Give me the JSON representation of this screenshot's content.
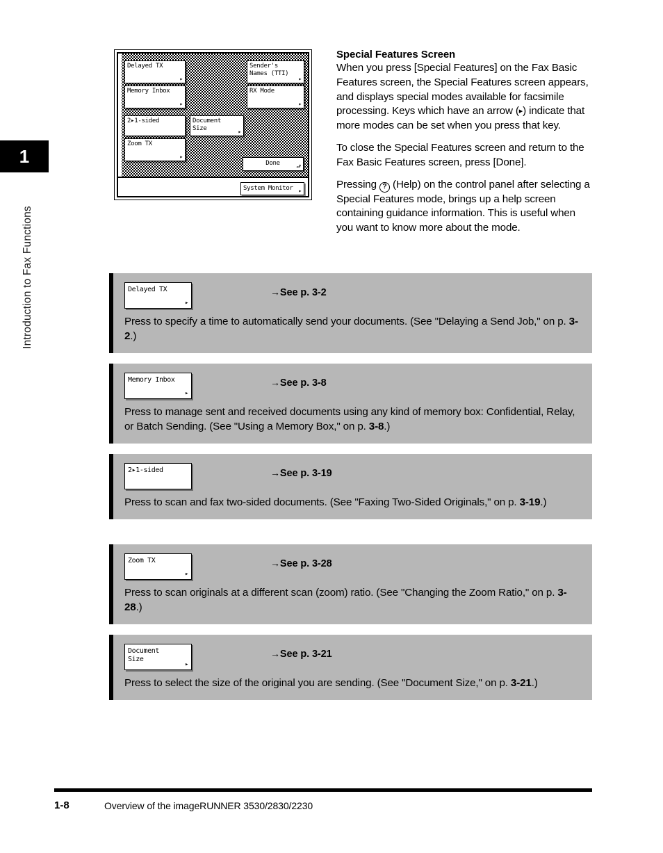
{
  "chapter": {
    "number": "1",
    "title": "Introduction to Fax Functions"
  },
  "figure": {
    "name": "special-features-lcd-screen",
    "keys": [
      {
        "id": "delayed-tx",
        "label": "Delayed TX",
        "arrow": "▸"
      },
      {
        "id": "memory-inbox",
        "label": "Memory Inbox",
        "arrow": "▸"
      },
      {
        "id": "senders-names",
        "label": "Sender's\nNames (TTI)",
        "arrow": "▸"
      },
      {
        "id": "rx-mode",
        "label": "RX Mode",
        "arrow": "▸"
      },
      {
        "id": "2-1-sided",
        "label": "2▸1-sided",
        "arrow": ""
      },
      {
        "id": "document-size",
        "label": "Document\nSize",
        "arrow": "▸"
      },
      {
        "id": "zoom-tx",
        "label": "Zoom TX",
        "arrow": "▸"
      },
      {
        "id": "done",
        "label": "Done",
        "arrow": "⮐"
      },
      {
        "id": "system-monitor",
        "label": "System Monitor",
        "arrow": "▸"
      }
    ],
    "key_labels": {
      "delayed_tx": "Delayed TX",
      "memory_inbox": "Memory Inbox",
      "senders_names_line1": "Sender's",
      "senders_names_line2": "Names (TTI)",
      "rx_mode": "RX Mode",
      "two_to_one_sided": "2▸1-sided",
      "document_size_line1": "Document",
      "document_size_line2": "Size",
      "zoom_tx": "Zoom TX",
      "done": "Done",
      "system_monitor": "System Monitor"
    }
  },
  "section": {
    "heading": "Special Features Screen",
    "paragraph_1_part_a": "When you press [Special Features] on the Fax Basic Features screen, the Special Features screen appears, and displays special modes available for facsimile processing. Keys which have an arrow (",
    "paragraph_1_arrow": "▸",
    "paragraph_1_part_b": ") indicate that more modes can be set when you press that key.",
    "paragraph_2": "To close the Special Features screen and return to the Fax Basic Features screen, press [Done].",
    "paragraph_3_part_a": "Pressing ",
    "paragraph_3_help_icon": "?",
    "paragraph_3_part_b": " (Help) on the control panel after selecting a Special Features mode, brings up a help screen containing guidance information. This is useful when you want to know more about the mode."
  },
  "callouts": [
    {
      "key_line1": "Delayed TX",
      "key_line2": "",
      "key_arrow": "▸",
      "ref_arrow": "→",
      "ref_text": "See p. 3-2",
      "body_a": "Press to specify a time to automatically send your documents. (See \"Delaying a Send Job,\" on p. ",
      "body_bold": "3-2",
      "body_b": ".)"
    },
    {
      "key_line1": "Memory Inbox",
      "key_line2": "",
      "key_arrow": "▸",
      "ref_arrow": "→",
      "ref_text": "See p. 3-8",
      "body_a": "Press to manage sent and received documents using any kind of memory box: Confidential, Relay, or Batch Sending. (See \"Using a Memory Box,\" on p. ",
      "body_bold": "3-8",
      "body_b": ".)"
    },
    {
      "key_line1": "2▸1-sided",
      "key_line2": "",
      "key_arrow": "",
      "ref_arrow": "→",
      "ref_text": "See p. 3-19",
      "body_a": "Press to scan and fax two-sided documents. (See \"Faxing Two-Sided Originals,\" on p. ",
      "body_bold": "3-19",
      "body_b": ".)"
    },
    {
      "key_line1": "Zoom TX",
      "key_line2": "",
      "key_arrow": "▸",
      "ref_arrow": "→",
      "ref_text": "See p. 3-28",
      "body_a": "Press to scan originals at a different scan (zoom) ratio. (See \"Changing the Zoom Ratio,\" on p. ",
      "body_bold": "3-28",
      "body_b": ".)"
    },
    {
      "key_line1": "Document",
      "key_line2": "Size",
      "key_arrow": "▸",
      "ref_arrow": "→",
      "ref_text": "See p. 3-21",
      "body_a": "Press to select the size of the original you are sending. (See \"Document Size,\" on p. ",
      "body_bold": "3-21",
      "body_b": ".)"
    }
  ],
  "footer": {
    "page_number": "1-8",
    "text": "Overview of the imageRUNNER 3530/2830/2230"
  },
  "colors": {
    "callout_background": "#b7b7b7",
    "rule": "#000000",
    "tab_background": "#000000"
  }
}
